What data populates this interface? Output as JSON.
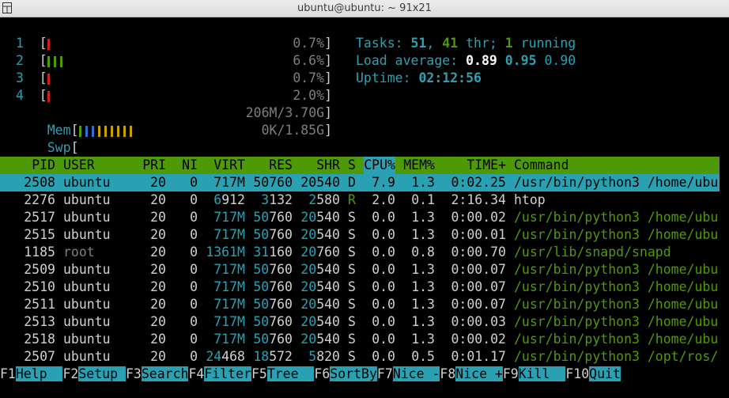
{
  "window": {
    "title": "ubuntu@ubuntu: ~ 91x21"
  },
  "colors": {
    "accent_cyan": "#2aa1b3",
    "header_green": "#4e9a06"
  },
  "meters": [
    {
      "label": "1",
      "value": "0.7%",
      "bars": 1
    },
    {
      "label": "2",
      "value": "6.6%",
      "bars": 3
    },
    {
      "label": "3",
      "value": "0.7%",
      "bars": 1
    },
    {
      "label": "4",
      "value": "2.0%",
      "bars": 1
    }
  ],
  "mem": {
    "label": "Mem",
    "value": "206M/3.70G"
  },
  "swp": {
    "label": "Swp",
    "value": "0K/1.85G"
  },
  "summary": {
    "tasks_label": "Tasks: ",
    "tasks": "51",
    "thr": "41",
    "thr_label": " thr; ",
    "running": "1",
    "running_label": " running",
    "load_label": "Load average: ",
    "load1": "0.89",
    "load5": "0.95",
    "load15": "0.90",
    "uptime_label": "Uptime: ",
    "uptime": "02:12:56"
  },
  "table": {
    "columns": [
      "PID",
      "USER",
      "PRI",
      "NI",
      "VIRT",
      "RES",
      "SHR",
      "S",
      "CPU%",
      "MEM%",
      "TIME+",
      "Command"
    ],
    "rows": [
      [
        "2508",
        "ubuntu",
        "20",
        "0",
        "717M",
        "50760",
        "20540",
        "D",
        "7.9",
        "1.3",
        "0:02.25",
        "/usr/bin/python3 /home/ubu"
      ],
      [
        "2276",
        "ubuntu",
        "20",
        "0",
        "6912",
        "3132",
        "2580",
        "R",
        "2.0",
        "0.1",
        "2:16.34",
        "htop"
      ],
      [
        "2517",
        "ubuntu",
        "20",
        "0",
        "717M",
        "50760",
        "20540",
        "S",
        "0.0",
        "1.3",
        "0:00.02",
        "/usr/bin/python3 /home/ubu"
      ],
      [
        "2515",
        "ubuntu",
        "20",
        "0",
        "717M",
        "50760",
        "20540",
        "S",
        "0.0",
        "1.3",
        "0:00.01",
        "/usr/bin/python3 /home/ubu"
      ],
      [
        "1185",
        "root",
        "20",
        "0",
        "1361M",
        "31160",
        "20760",
        "S",
        "0.0",
        "0.8",
        "0:00.70",
        "/usr/lib/snapd/snapd"
      ],
      [
        "2509",
        "ubuntu",
        "20",
        "0",
        "717M",
        "50760",
        "20540",
        "S",
        "0.0",
        "1.3",
        "0:00.07",
        "/usr/bin/python3 /home/ubu"
      ],
      [
        "2510",
        "ubuntu",
        "20",
        "0",
        "717M",
        "50760",
        "20540",
        "S",
        "0.0",
        "1.3",
        "0:00.07",
        "/usr/bin/python3 /home/ubu"
      ],
      [
        "2511",
        "ubuntu",
        "20",
        "0",
        "717M",
        "50760",
        "20540",
        "S",
        "0.0",
        "1.3",
        "0:00.07",
        "/usr/bin/python3 /home/ubu"
      ],
      [
        "2513",
        "ubuntu",
        "20",
        "0",
        "717M",
        "50760",
        "20540",
        "S",
        "0.0",
        "1.3",
        "0:00.03",
        "/usr/bin/python3 /home/ubu"
      ],
      [
        "2518",
        "ubuntu",
        "20",
        "0",
        "717M",
        "50760",
        "20540",
        "S",
        "0.0",
        "1.3",
        "0:00.02",
        "/usr/bin/python3 /home/ubu"
      ],
      [
        "2507",
        "ubuntu",
        "20",
        "0",
        "24468",
        "18572",
        "5820",
        "S",
        "0.0",
        "0.5",
        "0:01.17",
        "/usr/bin/python3 /opt/ros/"
      ]
    ]
  },
  "function_keys": [
    {
      "key": "F1",
      "label": "Help  "
    },
    {
      "key": "F2",
      "label": "Setup "
    },
    {
      "key": "F3",
      "label": "Search"
    },
    {
      "key": "F4",
      "label": "Filter"
    },
    {
      "key": "F5",
      "label": "Tree  "
    },
    {
      "key": "F6",
      "label": "SortBy"
    },
    {
      "key": "F7",
      "label": "Nice -"
    },
    {
      "key": "F8",
      "label": "Nice +"
    },
    {
      "key": "F9",
      "label": "Kill  "
    },
    {
      "key": "F10",
      "label": "Quit"
    }
  ]
}
